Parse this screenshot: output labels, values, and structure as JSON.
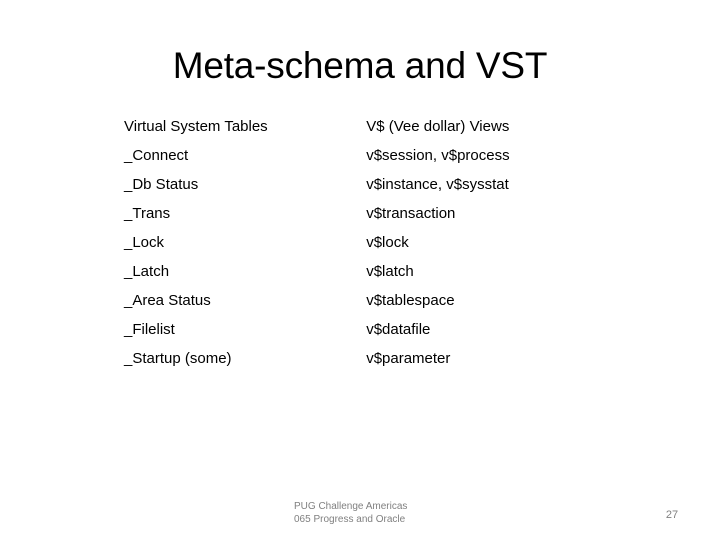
{
  "slide": {
    "title": "Meta-schema and VST",
    "page_number": "27",
    "background_color": "#ffffff",
    "text_color": "#000000",
    "footer_color": "#808080"
  },
  "table": {
    "headers": {
      "left": "Virtual System Tables",
      "right": "V$ (Vee dollar) Views"
    },
    "rows": [
      {
        "vst": "_Connect",
        "views": "v$session, v$process"
      },
      {
        "vst": "_Db Status",
        "views": "v$instance, v$sysstat"
      },
      {
        "vst": "_Trans",
        "views": "v$transaction"
      },
      {
        "vst": "_Lock",
        "views": "v$lock"
      },
      {
        "vst": "_Latch",
        "views": "v$latch"
      },
      {
        "vst": "_Area Status",
        "views": "v$tablespace"
      },
      {
        "vst": "_Filelist",
        "views": "v$datafile"
      },
      {
        "vst": "_Startup (some)",
        "views": "v$parameter"
      }
    ]
  },
  "footer": {
    "line1": "PUG Challenge Americas",
    "line2": "065 Progress and Oracle"
  }
}
